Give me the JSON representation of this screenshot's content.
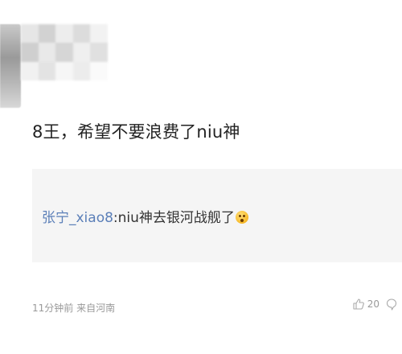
{
  "comment": {
    "text": "8王，希望不要浪费了niu神"
  },
  "reply": {
    "username": "张宁_xiao8",
    "separator": ":",
    "text": "niu神去银河战舰了",
    "emoji": "emoji-icon"
  },
  "meta": {
    "time_location": "11分钟前 来自河南"
  },
  "actions": {
    "like_count": "20",
    "like_icon": "thumbs-up-icon",
    "comment_icon": "comment-icon"
  },
  "colors": {
    "username_link": "#5b7fb8",
    "reply_background": "#f5f5f5",
    "meta_text": "#999999",
    "body_text": "#222222"
  }
}
